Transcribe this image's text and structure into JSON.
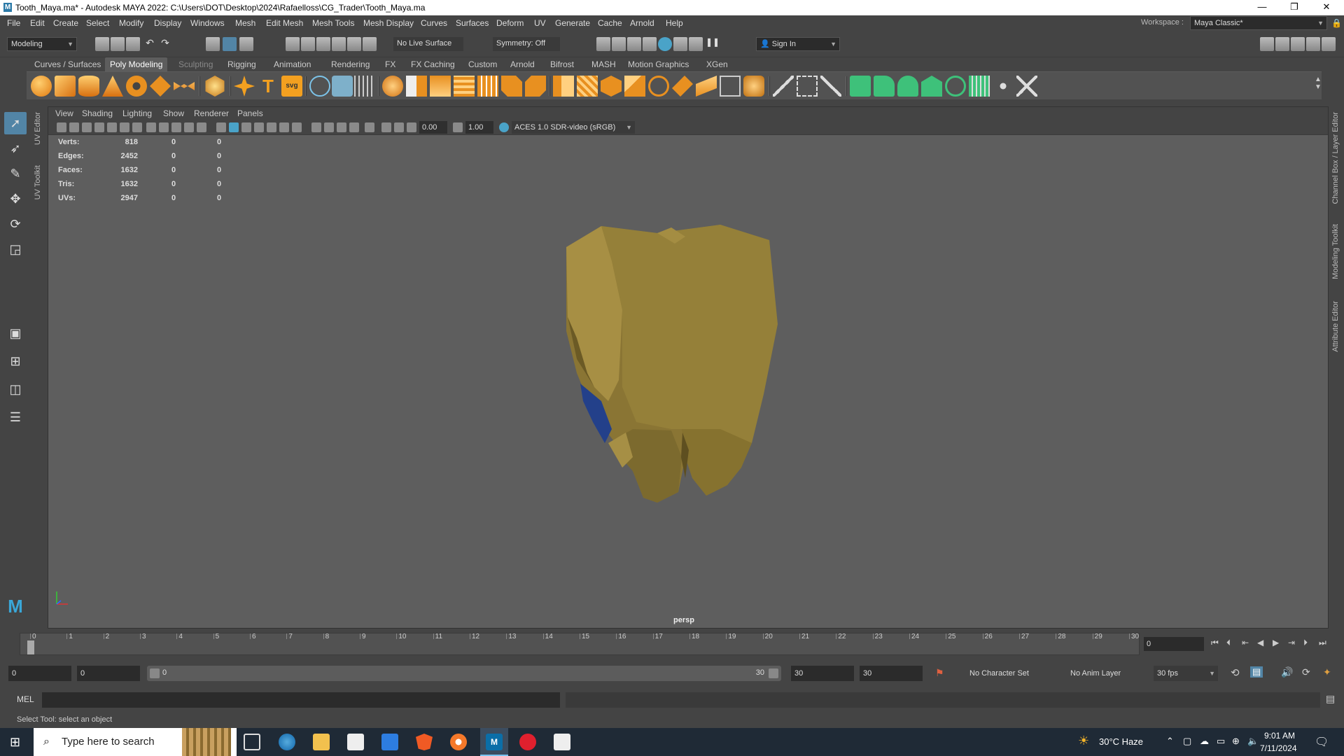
{
  "window": {
    "title": "Tooth_Maya.ma* - Autodesk MAYA 2022: C:\\Users\\DOT\\Desktop\\2024\\Rafaelloss\\CG_Trader\\Tooth_Maya.ma",
    "logo": "M"
  },
  "menu": [
    "File",
    "Edit",
    "Create",
    "Select",
    "Modify",
    "Display",
    "Windows",
    "Mesh",
    "Edit Mesh",
    "Mesh Tools",
    "Mesh Display",
    "Curves",
    "Surfaces",
    "Deform",
    "UV",
    "Generate",
    "Cache",
    "Arnold",
    "Help"
  ],
  "workspace": {
    "label": "Workspace :",
    "value": "Maya Classic*"
  },
  "statusline": {
    "mode": "Modeling",
    "live_surface": "No Live Surface",
    "symmetry": "Symmetry: Off",
    "sign_in": "Sign In"
  },
  "shelf_tabs": [
    "Curves / Surfaces",
    "Poly Modeling",
    "Sculpting",
    "Rigging",
    "Animation",
    "Rendering",
    "FX",
    "FX Caching",
    "Custom",
    "Arnold",
    "Bifrost",
    "MASH",
    "Motion Graphics",
    "XGen"
  ],
  "shelf_active": "Poly Modeling",
  "side_tabs": {
    "left1": "UV Editor",
    "left2": "UV Toolkit",
    "right1": "Channel Box / Layer Editor",
    "right2": "Modeling Toolkit",
    "right3": "Attribute Editor"
  },
  "viewport": {
    "menu": [
      "View",
      "Shading",
      "Lighting",
      "Show",
      "Renderer",
      "Panels"
    ],
    "exposure": "0.00",
    "gamma": "1.00",
    "color_space": "ACES 1.0 SDR-video (sRGB)",
    "camera": "persp",
    "hud": [
      {
        "label": "Verts:",
        "v1": "818",
        "v2": "0",
        "v3": "0"
      },
      {
        "label": "Edges:",
        "v1": "2452",
        "v2": "0",
        "v3": "0"
      },
      {
        "label": "Faces:",
        "v1": "1632",
        "v2": "0",
        "v3": "0"
      },
      {
        "label": "Tris:",
        "v1": "1632",
        "v2": "0",
        "v3": "0"
      },
      {
        "label": "UVs:",
        "v1": "2947",
        "v2": "0",
        "v3": "0"
      }
    ],
    "model_color": "#8f7a3b",
    "accent_blue": "#23408a"
  },
  "timeline": {
    "ticks": [
      "0",
      "1",
      "2",
      "3",
      "4",
      "5",
      "6",
      "7",
      "8",
      "9",
      "10",
      "11",
      "12",
      "13",
      "14",
      "15",
      "16",
      "17",
      "18",
      "19",
      "20",
      "21",
      "22",
      "23",
      "24",
      "25",
      "26",
      "27",
      "28",
      "29",
      "30"
    ],
    "current_frame": "0"
  },
  "range": {
    "start": "0",
    "anim_start": "0",
    "slider_start": "0",
    "slider_end": "30",
    "anim_end": "30",
    "end": "30",
    "character_set": "No Character Set",
    "anim_layer": "No Anim Layer",
    "fps": "30 fps"
  },
  "command": {
    "label": "MEL"
  },
  "help_line": "Select Tool: select an object",
  "taskbar": {
    "search_placeholder": "Type here to search",
    "weather": "30°C  Haze",
    "time": "9:01 AM",
    "date": "7/11/2024"
  }
}
